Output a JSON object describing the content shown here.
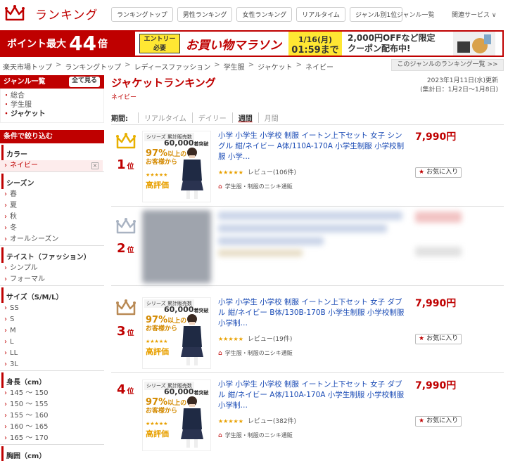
{
  "header": {
    "logo_text": "ランキング",
    "nav": [
      "ランキングトップ",
      "男性ランキング",
      "女性ランキング",
      "リアルタイム",
      "ジャンル別1位"
    ],
    "genre_list": "ジャンル一覧",
    "related": "関連サービス ∨"
  },
  "banner": {
    "p1": "ポイント最大",
    "p2": "44",
    "p3": "倍",
    "entry1": "エントリー",
    "entry2": "必要",
    "title": "お買い物マラソン",
    "date1": "1/16(月)",
    "date2": "01:59まで",
    "coupon1": "2,000円OFFなど限定",
    "coupon2": "クーポン配布中!"
  },
  "breadcrumb": [
    "楽天市場トップ",
    "ランキングトップ",
    "レディースファッション",
    "学生服",
    "ジャケット",
    "ネイビー"
  ],
  "breadcrumb_sep": ">",
  "genre_button": "このジャンルのランキング一覧 >>",
  "sidebar": {
    "genre_head": "ジャンル一覧",
    "see_all": "全て見る",
    "genres": [
      "総合",
      "学生服",
      "ジャケット"
    ],
    "filter_head": "条件で絞り込む",
    "sections": [
      {
        "title": "カラー",
        "items": [
          "ネイビー"
        ]
      },
      {
        "title": "シーズン",
        "items": [
          "春",
          "夏",
          "秋",
          "冬",
          "オールシーズン"
        ]
      },
      {
        "title": "テイスト（ファッション）",
        "items": [
          "シンプル",
          "フォーマル"
        ]
      },
      {
        "title": "サイズ（S/M/L）",
        "items": [
          "SS",
          "S",
          "M",
          "L",
          "LL",
          "3L"
        ]
      },
      {
        "title": "身長（cm）",
        "items": [
          "145 ～ 150",
          "150 ～ 155",
          "155 ～ 160",
          "160 ～ 165",
          "165 ～ 170"
        ]
      },
      {
        "title": "胸囲（cm）",
        "items": []
      }
    ],
    "clear_icon": "×"
  },
  "main": {
    "title": "ジャケットランキング",
    "sub": "ネイビー",
    "updated1": "2023年1月11日(水)更新",
    "updated2": "(集計日：1月2日～1月8日)",
    "period_label": "期間:",
    "periods": [
      "リアルタイム",
      "デイリー",
      "週間",
      "月間"
    ],
    "items": [
      {
        "rank": "1",
        "rank_suffix": "位",
        "title": "小学 小学生 小学校 制服 イートン上下セット 女子 シングル 紺/ネイビー A体/110A-170A 小学生制服 小学校制服 小学…",
        "price": "7,990円",
        "review": "レビュー(106件)",
        "shop": "学生服・制服のニシキ通販",
        "fav": "お気に入り",
        "crown": "gold"
      },
      {
        "rank": "2",
        "rank_suffix": "位",
        "crown": "silver"
      },
      {
        "rank": "3",
        "rank_suffix": "位",
        "title": "小学 小学生 小学校 制服 イートン上下セット 女子 ダブル 紺/ネイビー B体/130B-170B 小学生制服 小学校制服 小学制…",
        "price": "7,990円",
        "review": "レビュー(19件)",
        "shop": "学生服・制服のニシキ通販",
        "fav": "お気に入り",
        "crown": "bronze"
      },
      {
        "rank": "4",
        "rank_suffix": "位",
        "title": "小学 小学生 小学校 制服 イートン上下セット 女子 ダブル 紺/ネイビー A体/110A-170A 小学生制服 小学校制服 小学制…",
        "price": "7,990円",
        "review": "レビュー(382件)",
        "shop": "学生服・制服のニシキ通販",
        "fav": "お気に入り"
      }
    ],
    "thumb": {
      "badge": "シリーズ 累計販売数",
      "count": "60,000",
      "count_suffix": "着突破",
      "pct": "97%",
      "pct_text1": "以上の",
      "pct_text2": "お客様から",
      "stars": "★★★★★",
      "high": "高評価"
    }
  },
  "colors": {
    "accent": "#bf0000",
    "link": "#1a4bb5",
    "gold": "#e8b000",
    "silver": "#a9b3c2",
    "bronze": "#b98a55"
  }
}
